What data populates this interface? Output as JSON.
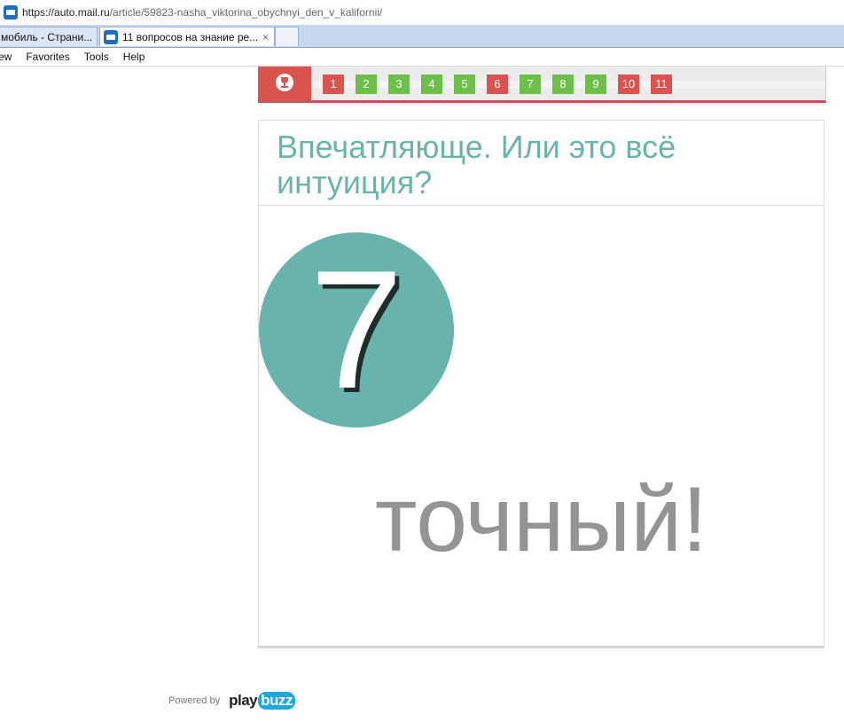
{
  "browser": {
    "url_main": "https://auto.mail.ru",
    "url_path": "/article/59823-nasha_viktorina_obychnyi_den_v_kalifornii/",
    "tabs": [
      {
        "label": "мобиль - Страни..."
      },
      {
        "label": "11 вопросов на знание ре...",
        "close": "×"
      }
    ],
    "menu": [
      "ew",
      "Favorites",
      "Tools",
      "Help"
    ]
  },
  "progress": {
    "icon": "trophy-icon",
    "questions": [
      {
        "label": "1",
        "status": "wrong"
      },
      {
        "label": "2",
        "status": "right"
      },
      {
        "label": "3",
        "status": "right"
      },
      {
        "label": "4",
        "status": "right"
      },
      {
        "label": "5",
        "status": "right"
      },
      {
        "label": "6",
        "status": "wrong"
      },
      {
        "label": "7",
        "status": "right"
      },
      {
        "label": "8",
        "status": "right"
      },
      {
        "label": "9",
        "status": "right"
      },
      {
        "label": "10",
        "status": "wrong"
      },
      {
        "label": "11",
        "status": "wrong"
      }
    ],
    "colors": {
      "wrong": "#d9534f",
      "right": "#6cc04a"
    }
  },
  "result": {
    "title": "Впечатляюще. Или это всё интуиция?",
    "score": "7",
    "word": "точный!",
    "colors": {
      "title": "#6ab4ab",
      "circle": "#68b3ab",
      "word": "#949494"
    }
  },
  "footer": {
    "powered_by": "Powered by",
    "brand_play": "play",
    "brand_buzz": "buzz"
  }
}
